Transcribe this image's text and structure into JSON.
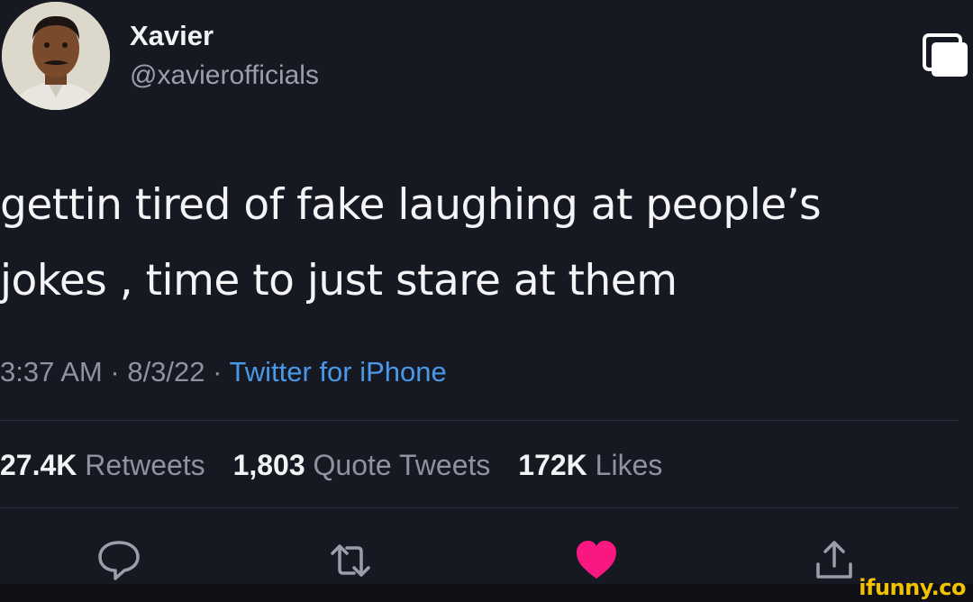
{
  "tweet": {
    "author": {
      "display_name": "Xavier",
      "handle": "@xavierofficials"
    },
    "text": "gettin tired of fake laughing at people’s jokes , time to just stare at them",
    "meta": {
      "time": "3:37 AM",
      "separator": "·",
      "date": "8/3/22",
      "source": "Twitter for iPhone"
    },
    "stats": {
      "retweets_count": "27.4K",
      "retweets_label": "Retweets",
      "quote_tweets_count": "1,803",
      "quote_tweets_label": "Quote Tweets",
      "likes_count": "172K",
      "likes_label": "Likes"
    },
    "actions": [
      {
        "icon": "reply-icon"
      },
      {
        "icon": "retweet-icon"
      },
      {
        "icon": "heart-icon",
        "liked": true,
        "color": "#f91880"
      },
      {
        "icon": "share-icon"
      }
    ]
  },
  "watermark": "ifunny.co",
  "colors": {
    "background": "#161822",
    "accent_link": "#4a99e9",
    "like": "#f91880",
    "watermark": "#f2c200"
  }
}
